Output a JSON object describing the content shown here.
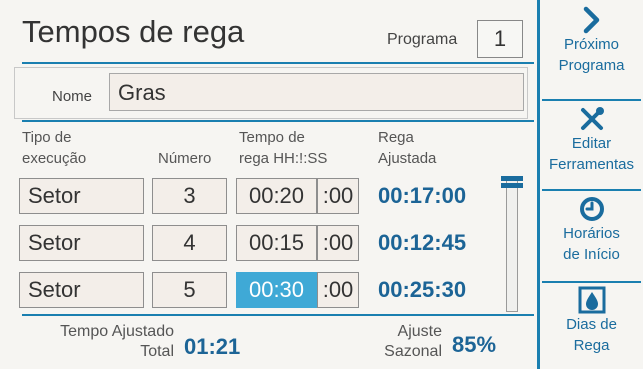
{
  "header": {
    "title": "Tempos de rega",
    "program_label": "Programa",
    "program_value": "1"
  },
  "name_row": {
    "label": "Nome",
    "value": "Gras"
  },
  "columns": {
    "type": [
      "Tipo de",
      "execução"
    ],
    "number": "Número",
    "time": [
      "Tempo de",
      "rega HH:!:SS"
    ],
    "adjusted": [
      "Rega",
      "Ajustada"
    ]
  },
  "rows": [
    {
      "type": "Setor",
      "number": "3",
      "hhmm": "00:20",
      "ss": ":00",
      "adjusted": "00:17:00",
      "selected": false
    },
    {
      "type": "Setor",
      "number": "4",
      "hhmm": "00:15",
      "ss": ":00",
      "adjusted": "00:12:45",
      "selected": false
    },
    {
      "type": "Setor",
      "number": "5",
      "hhmm": "00:30",
      "ss": ":00",
      "adjusted": "00:25:30",
      "selected": true
    }
  ],
  "footer": {
    "total_label": [
      "Tempo Ajustado",
      "Total"
    ],
    "total_value": "01:21",
    "seasonal_label": [
      "Ajuste",
      "Sazonal"
    ],
    "seasonal_value": "85%"
  },
  "scroll": {
    "position": 0
  },
  "sidebar": [
    {
      "icon": "chevron-right-icon",
      "lines": [
        "Próximo",
        "Programa"
      ]
    },
    {
      "icon": "tools-icon",
      "lines": [
        "Editar",
        "Ferramentas"
      ]
    },
    {
      "icon": "clock-icon",
      "lines": [
        "Horários",
        "de Início"
      ]
    },
    {
      "icon": "water-drop-icon",
      "lines": [
        "Dias de",
        "Rega"
      ]
    }
  ],
  "colors": {
    "accent": "#1a7fb0",
    "value": "#1c6496",
    "selected": "#3fa9d6",
    "field": "#f3eee9"
  }
}
